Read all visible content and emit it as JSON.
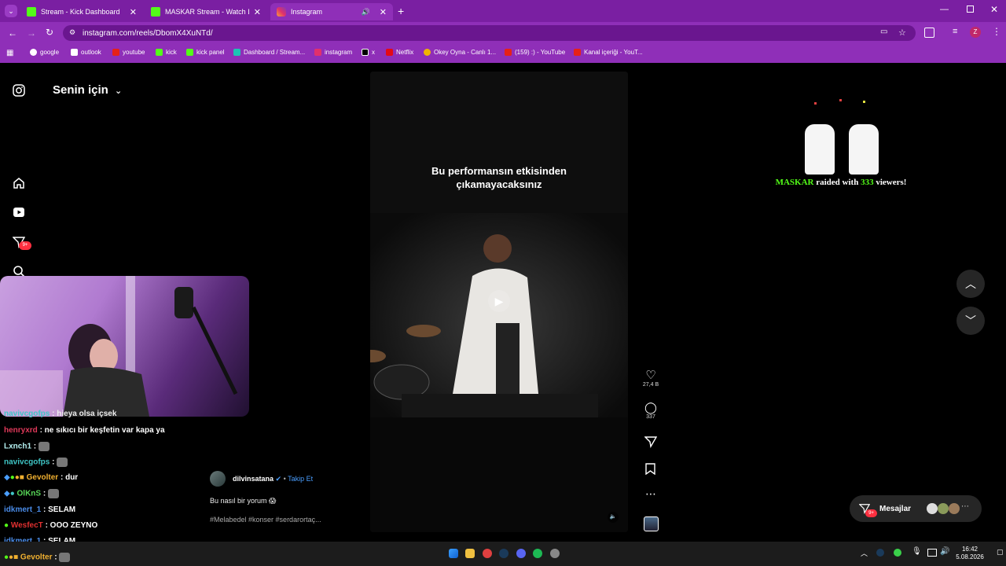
{
  "tabs": [
    {
      "label": "Stream - Kick Dashboard",
      "icon": "kick-icon"
    },
    {
      "label": "MASKAR Stream - Watch Live o",
      "icon": "kick-icon"
    },
    {
      "label": "Instagram",
      "icon": "instagram-icon"
    }
  ],
  "address": {
    "url": "instagram.com/reels/DbomX4XuNTd/"
  },
  "bookmarks": [
    {
      "label": "google",
      "color": "#ffffff"
    },
    {
      "label": "outlook",
      "color": "#ffffff"
    },
    {
      "label": "youtube",
      "color": "#e62117"
    },
    {
      "label": "kick",
      "color": "#53fc18"
    },
    {
      "label": "kick panel",
      "color": "#53fc18"
    },
    {
      "label": "Dashboard / Stream...",
      "color": "#1cc4b4"
    },
    {
      "label": "instagram",
      "color": "#e1306c"
    },
    {
      "label": "x",
      "color": "#000000"
    },
    {
      "label": "Netflix",
      "color": "#e50914"
    },
    {
      "label": "Okey Oyna - Canlı 1...",
      "color": "#f0b400"
    },
    {
      "label": "(159) :) - YouTube",
      "color": "#e62117"
    },
    {
      "label": "Kanal içeriği - YouT...",
      "color": "#e62117"
    }
  ],
  "feed": {
    "title": "Senin için",
    "notif_badge": "9+"
  },
  "reel": {
    "caption_line1": "Bu performansın etkisinden",
    "caption_line2": "çıkamayacaksınız",
    "likes": "27,4 B",
    "comments": "337",
    "author": "dilvinsatana",
    "follow": "Takip Et",
    "description": "Bu nasıl bir yorum 😱",
    "tags": "#Melabedel #konser #serdarortaç..."
  },
  "raid": {
    "name": "MASKAR",
    "text1": "raided with",
    "count": "333",
    "text2": "viewers!"
  },
  "messages": {
    "label": "Mesajlar",
    "badge": "9+"
  },
  "chat": [
    {
      "user": "navivcgofps",
      "color": "#3fc6c6",
      "msg": ": hieya olsa içsek"
    },
    {
      "user": "henryxrd",
      "color": "#e0395a",
      "msg": ": ne sıkıcı bir keşfetin var kapa ya"
    },
    {
      "user": "Lxnch1",
      "color": "#b4f0f0",
      "msg": ":"
    },
    {
      "user": "navivcgofps",
      "color": "#3fc6c6",
      "msg": ":"
    },
    {
      "user": "Gevolter",
      "color": "#f0b030",
      "msg": ": dur"
    },
    {
      "user": "OlKnS",
      "color": "#58d858",
      "msg": ":"
    },
    {
      "user": "idkmert_1",
      "color": "#4a8ce8",
      "msg": ": SELAM"
    },
    {
      "user": "WesfecT",
      "color": "#e03030",
      "msg": ": OOO ZEYNO"
    },
    {
      "user": "idkmert_1",
      "color": "#4a8ce8",
      "msg": ": SELAM"
    },
    {
      "user": "Gevolter",
      "color": "#f0b030",
      "msg": ":"
    }
  ],
  "clock": {
    "time": "16:42",
    "date": "5.08.2026"
  },
  "colors": {
    "tab_bar": "#7a1fa2",
    "toolbar": "#8f2fb8",
    "follow": "#4a9eff",
    "raid_green": "#53fc18"
  }
}
